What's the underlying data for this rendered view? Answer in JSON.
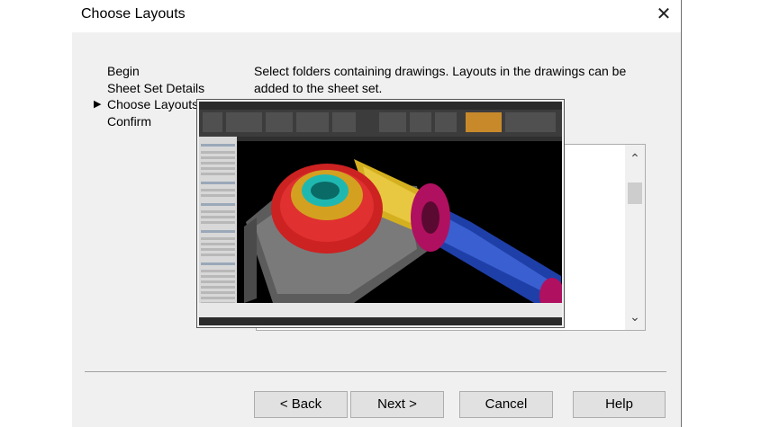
{
  "dialog": {
    "title": "Choose Layouts",
    "close_glyph": "✕"
  },
  "steps": [
    {
      "label": "Begin",
      "current": false
    },
    {
      "label": "Sheet Set Details",
      "current": false
    },
    {
      "label": "Choose Layouts",
      "current": true
    },
    {
      "label": "Confirm",
      "current": false
    }
  ],
  "current_step_marker": "▶",
  "instructions": "Select folders containing drawings. Layouts in the drawings can be added to the sheet set.",
  "listbox": {
    "scroll_up_glyph": "⌃",
    "scroll_down_glyph": "⌄"
  },
  "buttons": {
    "back": "< Back",
    "next": "Next >",
    "cancel": "Cancel",
    "help": "Help"
  },
  "overlay_image": {
    "description_icon": "cad-screenshot",
    "colors": {
      "gear_red": "#cc2222",
      "shaft_blue": "#1f3fa8",
      "collar_gold": "#d4b020",
      "flange_magenta": "#b01060",
      "bore_cyan": "#1fb8b0",
      "housing_gray": "#6e6e6e"
    }
  }
}
